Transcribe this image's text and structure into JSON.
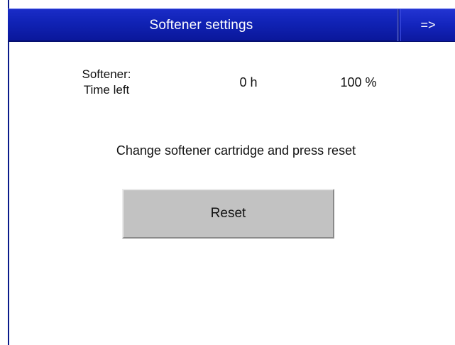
{
  "header": {
    "title": "Softener settings",
    "next_label": "=>"
  },
  "status": {
    "label_line1": "Softener:",
    "label_line2": "Time left",
    "hours_left": "0 h",
    "percent_left": "100 %"
  },
  "instruction": "Change softener cartridge and press reset",
  "reset_label": "Reset",
  "colors": {
    "header_blue": "#1022b4",
    "button_gray": "#c2c2c2",
    "background": "#ffffff"
  }
}
